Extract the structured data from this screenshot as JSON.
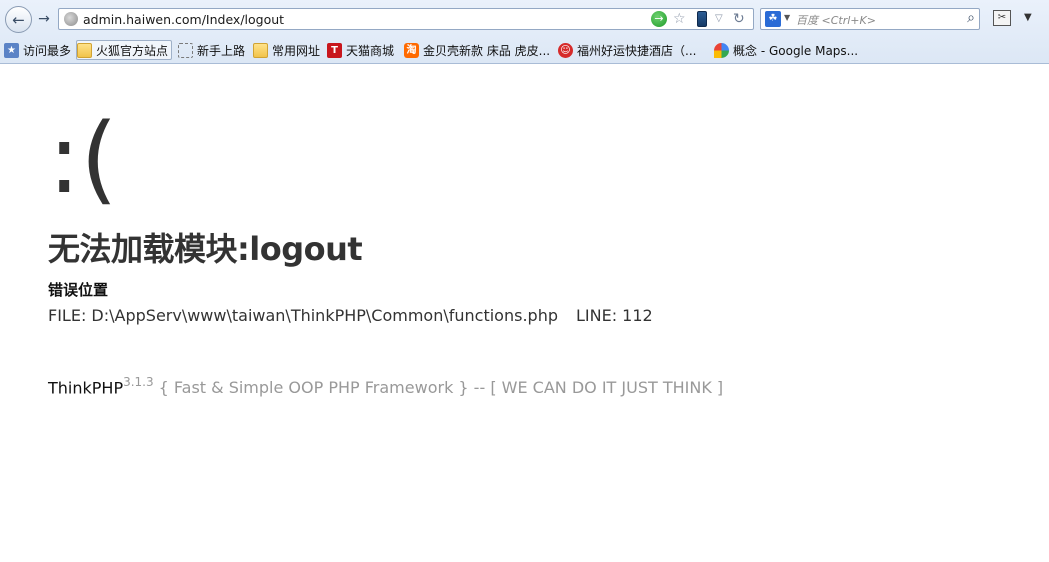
{
  "browser": {
    "url": "admin.haiwen.com/Index/logout",
    "search_placeholder": "百度 <Ctrl+K>",
    "search_engine_icon": "baidu-paw-icon"
  },
  "bookmarks": [
    {
      "label": "访问最多",
      "icon": "favorites-icon"
    },
    {
      "label": "火狐官方站点",
      "icon": "folder-icon"
    },
    {
      "label": "新手上路",
      "icon": "dashed-page-icon"
    },
    {
      "label": "常用网址",
      "icon": "folder-icon"
    },
    {
      "label": "天猫商城",
      "icon": "tmall-icon"
    },
    {
      "label": "金贝壳新款 床品 虎皮...",
      "icon": "taobao-icon"
    },
    {
      "label": "福州好运快捷酒店（...",
      "icon": "hotel-icon"
    },
    {
      "label": "概念 - Google Maps...",
      "icon": "google-maps-icon"
    }
  ],
  "error_page": {
    "face": ":(",
    "title": "无法加载模块:logout",
    "location_label": "错误位置",
    "file": "FILE: D:\\AppServ\\www\\taiwan\\ThinkPHP\\Common\\functions.php",
    "line": "LINE: 112",
    "brand": "ThinkPHP",
    "version": "3.1.3",
    "tagline": "{ Fast & Simple OOP PHP Framework } -- [ WE CAN DO IT JUST THINK ]"
  }
}
